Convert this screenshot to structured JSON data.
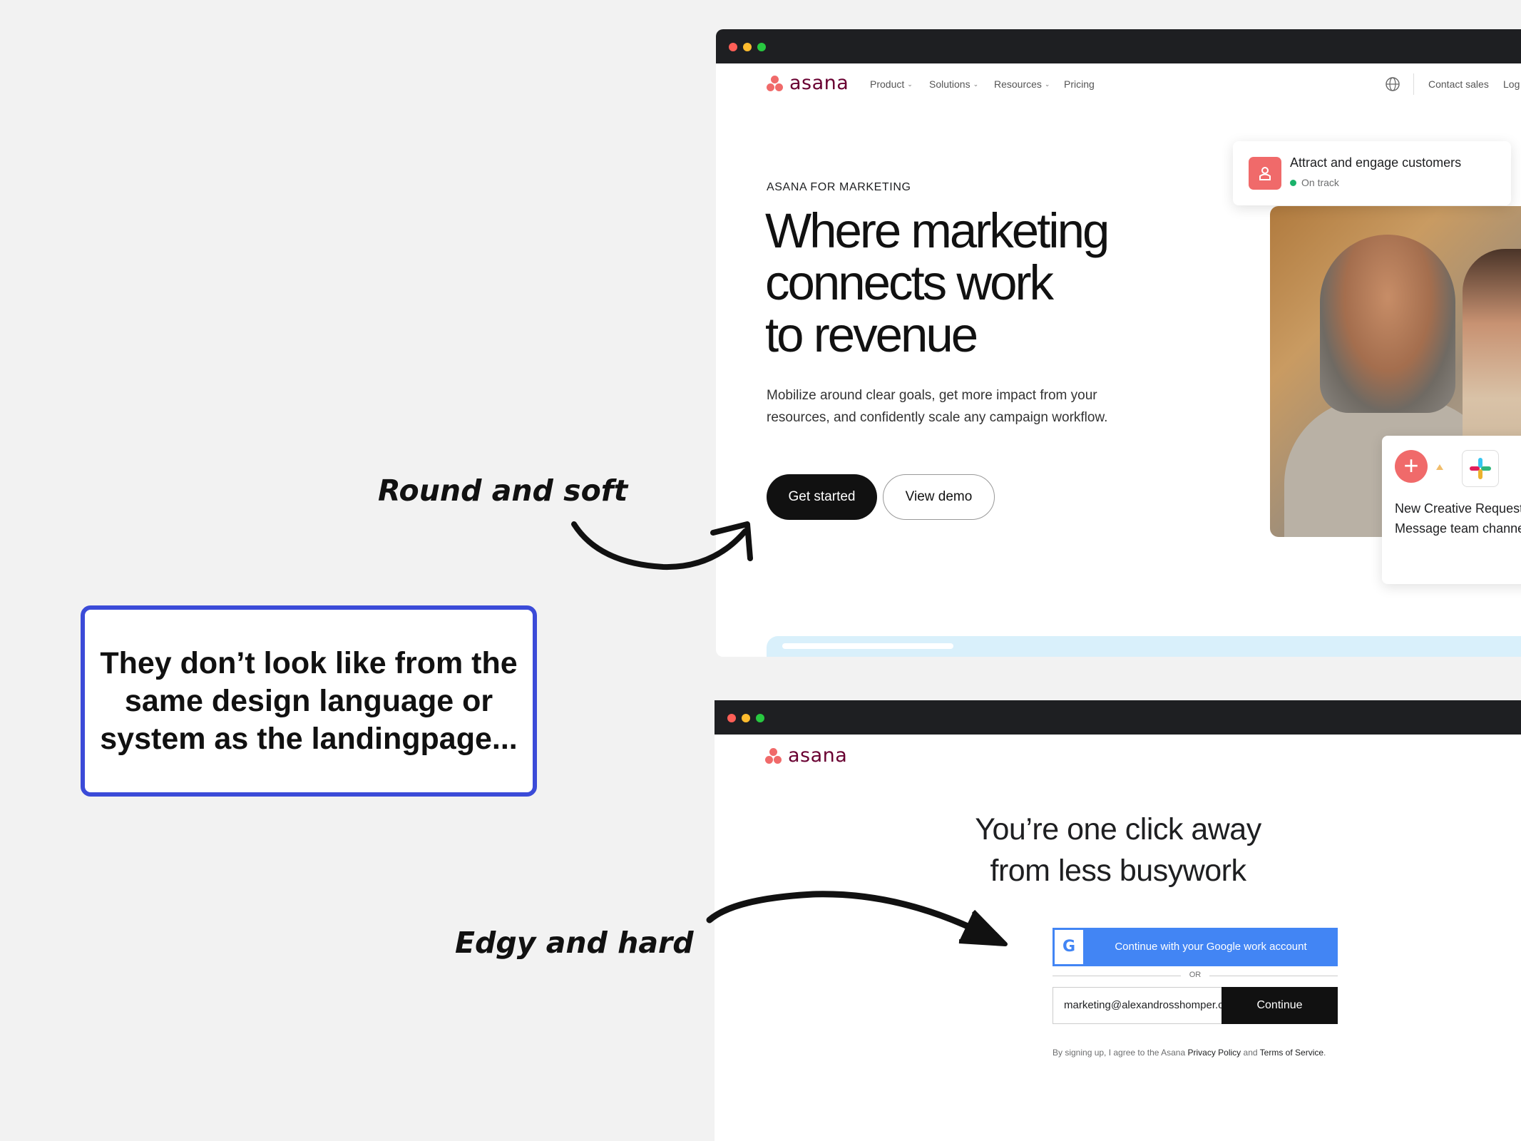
{
  "annotations": {
    "round_label": "Round and soft",
    "edgy_label": "Edgy and hard",
    "callout": "They don’t look like from the same design language or system as the landingpage..."
  },
  "window_dots": [
    "#ff5f57",
    "#febc2e",
    "#28c840"
  ],
  "brand": {
    "wordmark": "asana",
    "accent": "#f06a6a",
    "wordmark_color": "#690031"
  },
  "landing": {
    "nav": [
      {
        "label": "Product",
        "chevron": true
      },
      {
        "label": "Solutions",
        "chevron": true
      },
      {
        "label": "Resources",
        "chevron": true
      },
      {
        "label": "Pricing",
        "chevron": false
      }
    ],
    "globe_icon": "globe-icon",
    "contact_sales": "Contact sales",
    "login_partial": "Log",
    "eyebrow": "ASANA FOR MARKETING",
    "title_lines": [
      "Where marketing",
      "connects work",
      "to revenue"
    ],
    "description": "Mobilize around clear goals, get more impact from your resources, and confidently scale any campaign workflow.",
    "cta_primary": "Get started",
    "cta_secondary": "View demo",
    "goal_card": {
      "title": "Attract and engage customers",
      "status": "On track"
    },
    "workflow_card": {
      "line1": "New Creative Request",
      "line2": "Message team channel"
    }
  },
  "signup": {
    "title_lines": [
      "You’re one click away",
      "from less busywork"
    ],
    "google_button": "Continue with your Google work account",
    "or_label": "OR",
    "email_value": "marketing@alexandrosshomper.com",
    "continue_button": "Continue",
    "legal_prefix": "By signing up, I agree to the Asana",
    "privacy_link": "Privacy Policy",
    "legal_and": "and",
    "terms_link": "Terms of Service",
    "legal_suffix": "."
  }
}
